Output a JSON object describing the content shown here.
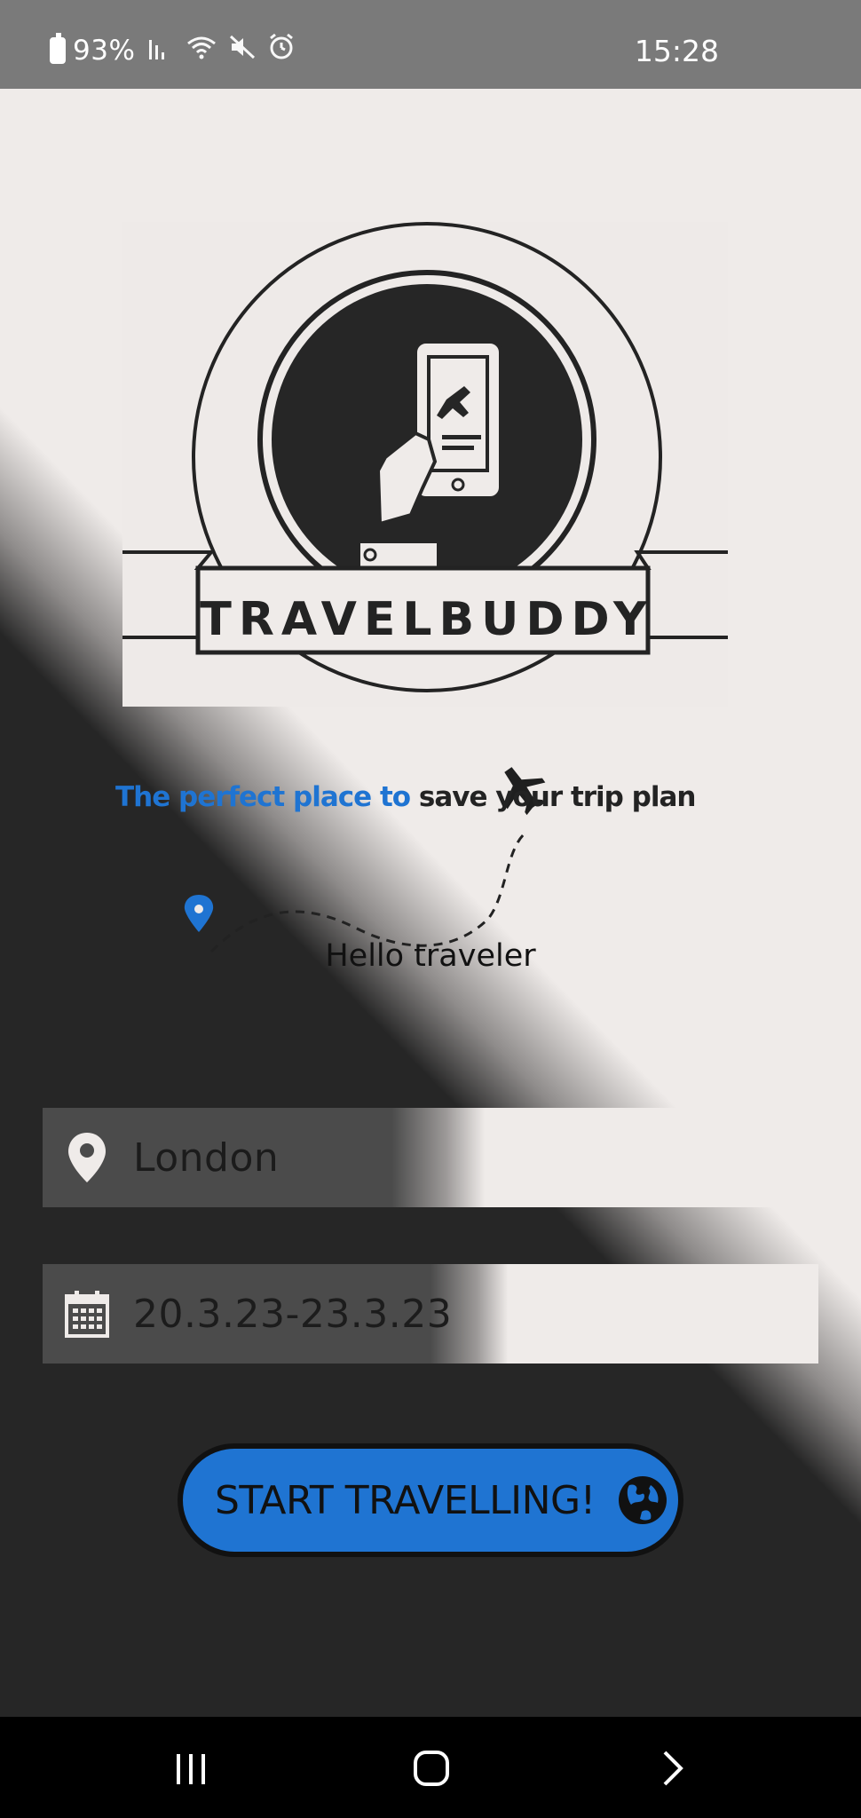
{
  "status_bar": {
    "battery": "93%",
    "time": "15:28",
    "icons": [
      "battery-charging-icon",
      "signal-icon",
      "wifi-icon",
      "mute-icon",
      "alarm-icon"
    ]
  },
  "logo": {
    "brand_text": "TRAVELBUDDY"
  },
  "tagline": {
    "part_blue": "The perfect place to",
    "part_dark": "save your trip plan"
  },
  "greeting": "Hello traveler",
  "location_field": {
    "icon": "location-pin-icon",
    "value": "London"
  },
  "dates_field": {
    "icon": "calendar-icon",
    "value": "20.3.23-23.3.23"
  },
  "start_button": {
    "label": "START TRAVELLING!",
    "icon": "globe-icon"
  },
  "colors": {
    "accent_blue": "#1f74d2",
    "dark": "#262626",
    "light": "#efebe9"
  },
  "nav_bar": {
    "icons": [
      "recent-apps-icon",
      "home-icon",
      "back-icon"
    ]
  }
}
